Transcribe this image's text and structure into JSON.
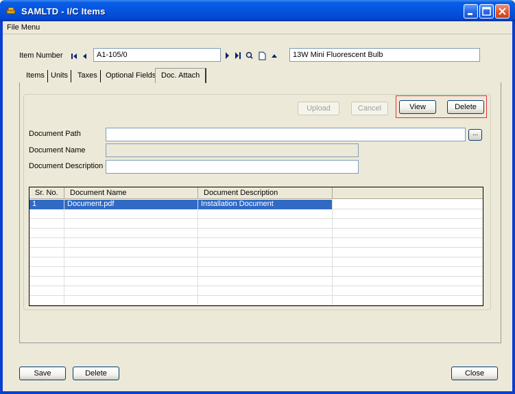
{
  "window": {
    "title": "SAMLTD - I/C Items"
  },
  "menu": {
    "file_menu": "File Menu"
  },
  "item": {
    "number_label": "Item Number",
    "number_value": "A1-105/0",
    "description_value": "13W Mini Fluorescent Bulb"
  },
  "tabs": [
    {
      "label": "Items"
    },
    {
      "label": "Units"
    },
    {
      "label": "Taxes"
    },
    {
      "label": "Optional Fields"
    },
    {
      "label": "Doc. Attach"
    }
  ],
  "doc": {
    "upload_label": "Upload",
    "cancel_label": "Cancel",
    "view_label": "View",
    "delete_label": "Delete",
    "path_label": "Document Path",
    "name_label": "Document Name",
    "description_label": "Document Description",
    "browse_label": "..."
  },
  "grid": {
    "headers": [
      "Sr. No.",
      "Document Name",
      "Document Description"
    ],
    "rows": [
      [
        "1",
        "Document.pdf",
        "Installation Document"
      ]
    ]
  },
  "footer": {
    "save_label": "Save",
    "delete_label": "Delete",
    "close_label": "Close"
  },
  "colors": {
    "selection": "#316ac5",
    "titlebar": "#0454e0",
    "highlight_box": "#e03030"
  }
}
